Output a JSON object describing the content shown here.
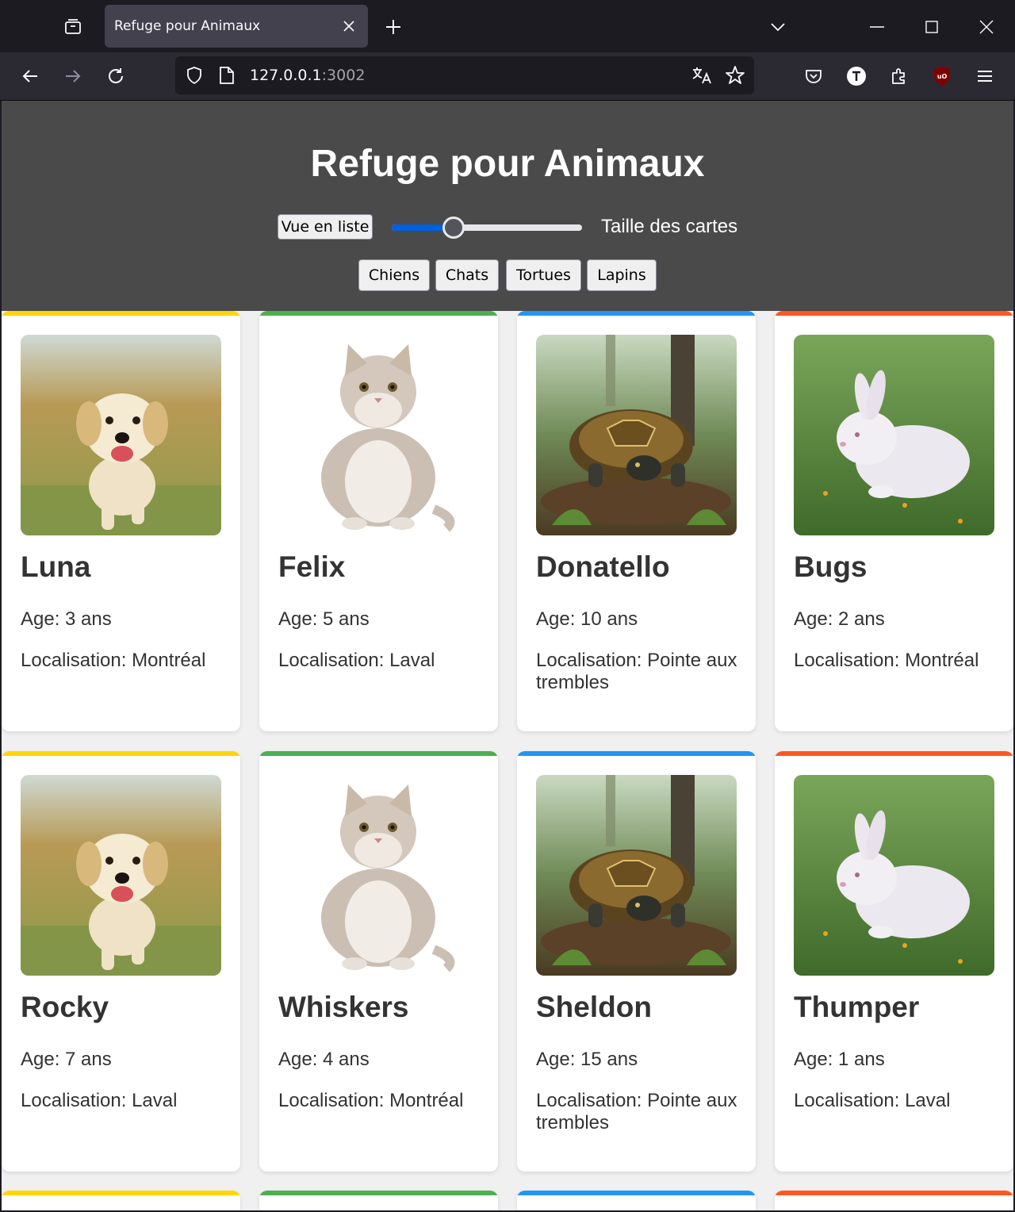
{
  "browser": {
    "tab_title": "Refuge pour Animaux",
    "url_host": "127.0.0.1",
    "url_port": ":3002"
  },
  "header": {
    "title": "Refuge pour Animaux",
    "view_button": "Vue en liste",
    "slider_label": "Taille des cartes",
    "slider_value_percent": 30,
    "filters": [
      "Chiens",
      "Chats",
      "Tortues",
      "Lapins"
    ]
  },
  "colors": {
    "dog": "#ffd600",
    "cat": "#4caf50",
    "turtle": "#2196f3",
    "rabbit": "#ff5722"
  },
  "animals": [
    {
      "name": "Luna",
      "age": "Age: 3 ans",
      "location": "Localisation: Montréal",
      "type": "dog"
    },
    {
      "name": "Felix",
      "age": "Age: 5 ans",
      "location": "Localisation: Laval",
      "type": "cat"
    },
    {
      "name": "Donatello",
      "age": "Age: 10 ans",
      "location": "Localisation: Pointe aux trembles",
      "type": "turtle"
    },
    {
      "name": "Bugs",
      "age": "Age: 2 ans",
      "location": "Localisation: Montréal",
      "type": "rabbit"
    },
    {
      "name": "Rocky",
      "age": "Age: 7 ans",
      "location": "Localisation: Laval",
      "type": "dog"
    },
    {
      "name": "Whiskers",
      "age": "Age: 4 ans",
      "location": "Localisation: Montréal",
      "type": "cat"
    },
    {
      "name": "Sheldon",
      "age": "Age: 15 ans",
      "location": "Localisation: Pointe aux trembles",
      "type": "turtle"
    },
    {
      "name": "Thumper",
      "age": "Age: 1 ans",
      "location": "Localisation: Laval",
      "type": "rabbit"
    }
  ]
}
